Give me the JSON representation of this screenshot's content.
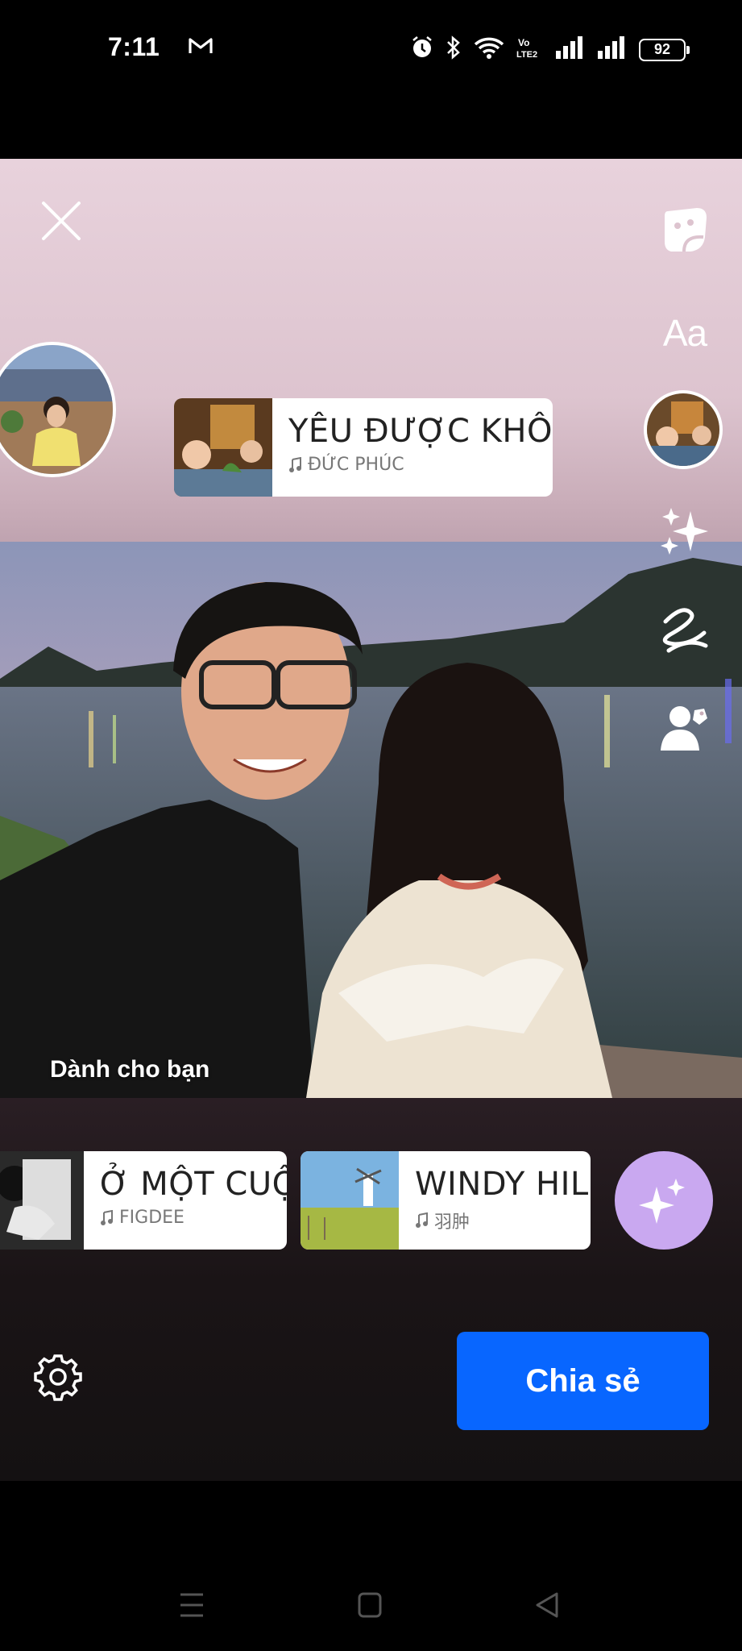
{
  "status_bar": {
    "time": "7:11",
    "battery": "92",
    "icons": [
      "gmail-icon",
      "alarm-icon",
      "bluetooth-icon",
      "wifi-icon",
      "volte-icon",
      "signal-icon",
      "signal-icon",
      "battery-icon"
    ]
  },
  "editor": {
    "close_icon": "close-icon",
    "tools": {
      "sticker_icon": "sticker-icon",
      "text_label": "Aa",
      "music_icon": "music-avatar",
      "effects_icon": "sparkle-icon",
      "draw_icon": "squiggle-icon",
      "tag_icon": "tag-people-icon"
    },
    "music_sticker": {
      "title": "YÊU ĐƯỢC KHÔNG",
      "artist": "ĐỨC PHÚC"
    },
    "photo_caption": "Dành cho bạn"
  },
  "suggestions": [
    {
      "title": "Ở MỘT CUỘC",
      "artist": "FIGDEE"
    },
    {
      "title": "WINDY HILL",
      "artist": "羽肿"
    }
  ],
  "actions": {
    "share_label": "Chia sẻ",
    "settings_icon": "gear-icon",
    "ai_icon": "sparkle-icon"
  },
  "colors": {
    "share_button": "#0866ff",
    "sparkle_button": "#c9a8f0"
  }
}
